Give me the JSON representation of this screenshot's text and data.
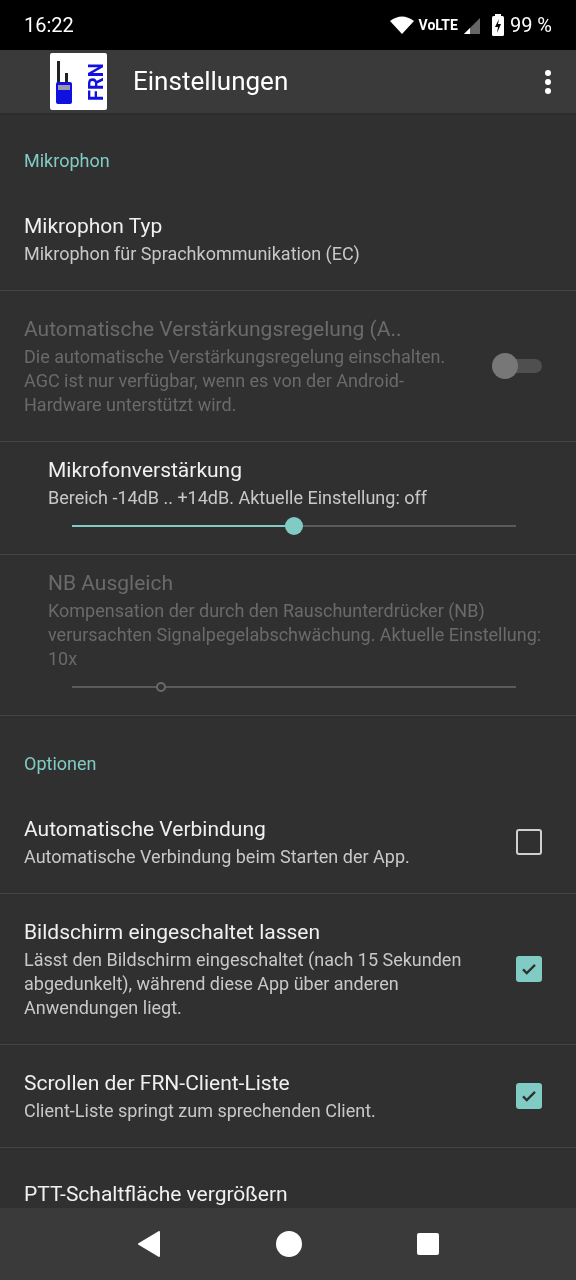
{
  "status_bar": {
    "time": "16:22",
    "network": "VoLTE",
    "battery": "99 %"
  },
  "app_bar": {
    "logo_text": "FRN",
    "title": "Einstellungen"
  },
  "items": [
    {
      "kind": "category",
      "title": "Mikrophon"
    },
    {
      "kind": "text",
      "title": "Mikrophon Typ",
      "summary": "Mikrophon für Sprachkommunikation (EC)",
      "disabled": false
    },
    {
      "kind": "switch",
      "title": "Automatische Verstärkungsregelung (A..",
      "summary": "Die automatische Verstärkungsregelung einschalten. AGC ist nur verfügbar, wenn es von der Android-Hardware unterstützt wird.",
      "disabled": true,
      "on": false
    },
    {
      "kind": "slider",
      "title": "Mikrofonverstärkung",
      "summary": "Bereich -14dB .. +14dB. Aktuelle Einstellung: off",
      "disabled": false,
      "level": 0.5
    },
    {
      "kind": "slider",
      "title": "NB Ausgleich",
      "summary": "Kompensation der durch den Rauschunterdrücker (NB) verursachten Signalpegelabschwächung. Aktuelle Einstellung: 10x",
      "disabled": true,
      "level": 0.2
    },
    {
      "kind": "category",
      "title": "Optionen"
    },
    {
      "kind": "checkbox",
      "title": "Automatische Verbindung",
      "summary": "Automatische Verbindung beim Starten der App.",
      "disabled": false,
      "checked": false
    },
    {
      "kind": "checkbox",
      "title": "Bildschirm eingeschaltet lassen",
      "summary": "Lässt den Bildschirm eingeschaltet (nach 15 Sekunden abgedunkelt), während diese App über anderen Anwendungen liegt.",
      "disabled": false,
      "checked": true
    },
    {
      "kind": "checkbox",
      "title": "Scrollen der FRN-Client-Liste",
      "summary": "Client-Liste springt zum sprechenden Client.",
      "disabled": false,
      "checked": true
    },
    {
      "kind": "text",
      "title": "PTT-Schaltfläche vergrößern",
      "disabled": false
    }
  ]
}
